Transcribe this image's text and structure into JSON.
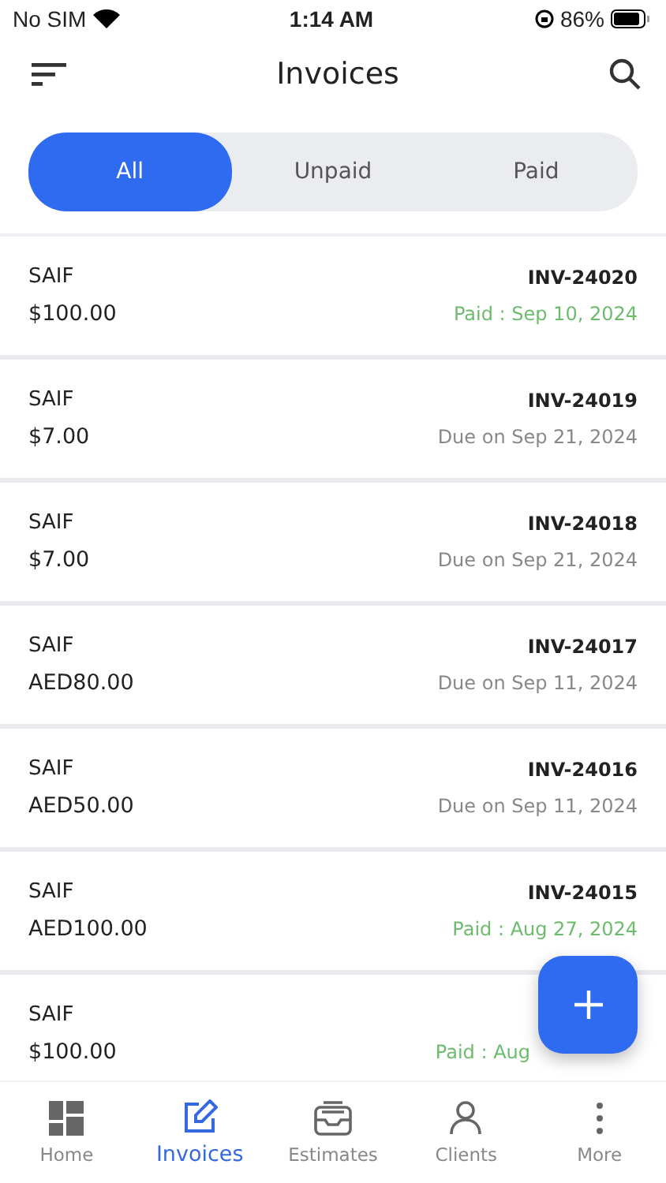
{
  "status_bar": {
    "carrier": "No SIM",
    "time": "1:14 AM",
    "battery": "86%"
  },
  "header": {
    "title": "Invoices"
  },
  "tabs": [
    {
      "label": "All",
      "selected": true
    },
    {
      "label": "Unpaid",
      "selected": false
    },
    {
      "label": "Paid",
      "selected": false
    }
  ],
  "invoices": [
    {
      "client": "SAIF",
      "amount": "$100.00",
      "number": "INV-24020",
      "status": "Paid : Sep 10, 2024",
      "kind": "paid"
    },
    {
      "client": "SAIF",
      "amount": "$7.00",
      "number": "INV-24019",
      "status": "Due on Sep 21, 2024",
      "kind": "due"
    },
    {
      "client": "SAIF",
      "amount": "$7.00",
      "number": "INV-24018",
      "status": "Due on Sep 21, 2024",
      "kind": "due"
    },
    {
      "client": "SAIF",
      "amount": "AED80.00",
      "number": "INV-24017",
      "status": "Due on Sep 11, 2024",
      "kind": "due"
    },
    {
      "client": "SAIF",
      "amount": "AED50.00",
      "number": "INV-24016",
      "status": "Due on Sep 11, 2024",
      "kind": "due"
    },
    {
      "client": "SAIF",
      "amount": "AED100.00",
      "number": "INV-24015",
      "status": "Paid : Aug 27, 2024",
      "kind": "paid"
    },
    {
      "client": "SAIF",
      "amount": "$100.00",
      "status": "Paid : Aug",
      "kind": "paid"
    }
  ],
  "nav": [
    {
      "label": "Home",
      "selected": false
    },
    {
      "label": "Invoices",
      "selected": true
    },
    {
      "label": "Estimates",
      "selected": false
    },
    {
      "label": "Clients",
      "selected": false
    },
    {
      "label": "More",
      "selected": false
    }
  ]
}
